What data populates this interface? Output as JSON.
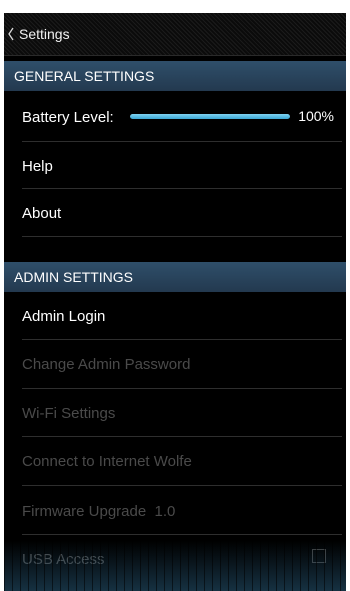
{
  "window": {
    "title": "Settings",
    "back_icon": "chevron-left-icon"
  },
  "general": {
    "header": "GENERAL SETTINGS",
    "battery": {
      "label": "Battery Level:",
      "value_text": "100%",
      "level_percent": 100
    },
    "help_label": "Help",
    "about_label": "About"
  },
  "admin": {
    "header": "ADMIN SETTINGS",
    "login_label": "Admin Login",
    "change_password_label": "Change Admin Password",
    "wifi_label": "Wi-Fi Settings",
    "connect_label": "Connect to Internet Wolfe",
    "firmware_label": "Firmware Upgrade  1.0",
    "usb_label": "USB Access",
    "usb_checked": false
  },
  "colors": {
    "section_header_bg": "#2f4f6a",
    "battery_fill": "#58bde6",
    "disabled_text": "#4a4a4a"
  }
}
